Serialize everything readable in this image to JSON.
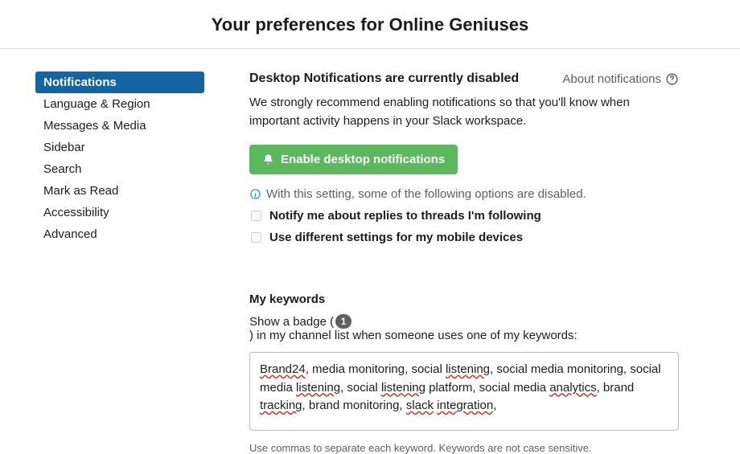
{
  "header": {
    "title": "Your preferences for Online Geniuses"
  },
  "sidebar": {
    "items": [
      {
        "label": "Notifications",
        "active": true
      },
      {
        "label": "Language & Region",
        "active": false
      },
      {
        "label": "Messages & Media",
        "active": false
      },
      {
        "label": "Sidebar",
        "active": false
      },
      {
        "label": "Search",
        "active": false
      },
      {
        "label": "Mark as Read",
        "active": false
      },
      {
        "label": "Accessibility",
        "active": false
      },
      {
        "label": "Advanced",
        "active": false
      }
    ]
  },
  "notifications": {
    "section_title": "Desktop Notifications are currently disabled",
    "about_link": "About notifications",
    "description": "We strongly recommend enabling notifications so that you'll know when important activity happens in your Slack workspace.",
    "enable_button": "Enable desktop notifications",
    "info_text": "With this setting, some of the following options are disabled.",
    "checkbox_threads": "Notify me about replies to threads I'm following",
    "checkbox_mobile": "Use different settings for my mobile devices"
  },
  "keywords": {
    "heading": "My keywords",
    "desc_prefix": "Show a badge (",
    "badge_number": "1",
    "desc_suffix": ") in my channel list when someone uses one of my keywords:",
    "value": "Brand24, media monitoring, social listening, social media monitoring, social media listening, social listening platform, social media analytics, brand tracking, brand monitoring, slack integration,",
    "hint": "Use commas to separate each keyword. Keywords are not case sensitive."
  }
}
